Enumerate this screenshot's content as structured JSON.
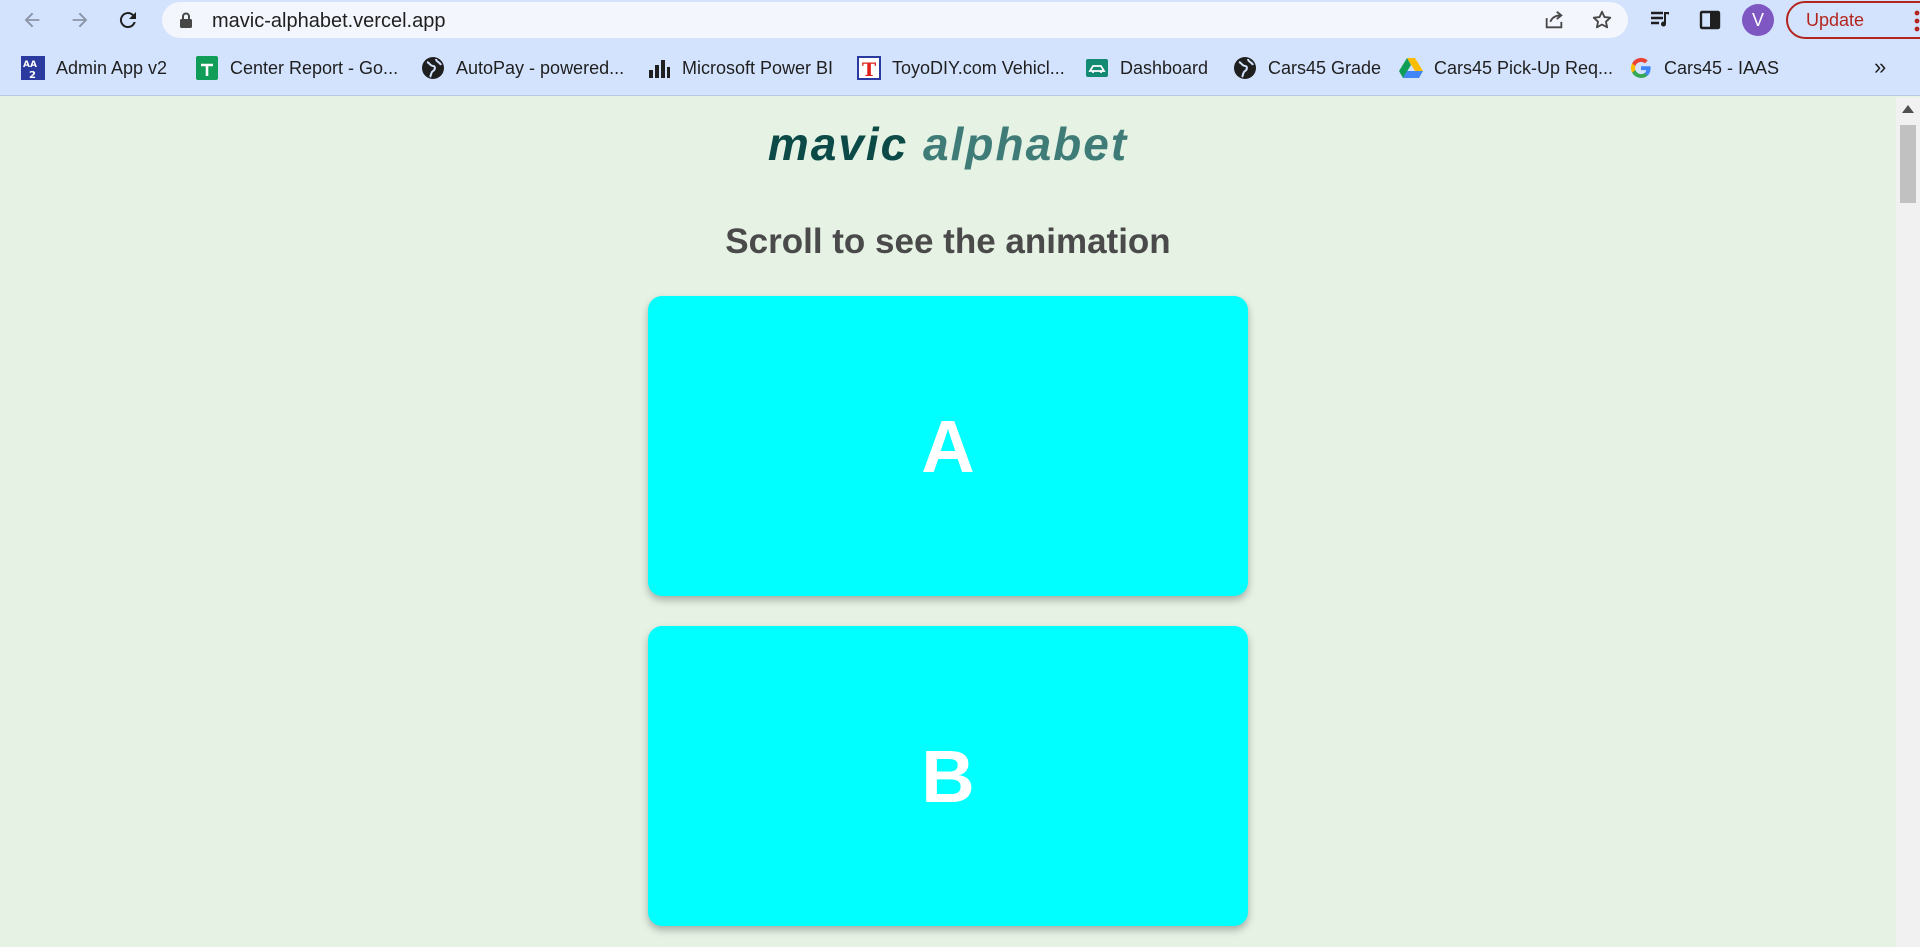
{
  "browser": {
    "url": "mavic-alphabet.vercel.app",
    "profile_initial": "V",
    "update_label": "Update"
  },
  "bookmarks": [
    {
      "label": "Admin App v2",
      "icon": "admin-app-icon"
    },
    {
      "label": "Center Report - Go...",
      "icon": "sheets-icon"
    },
    {
      "label": "AutoPay - powered...",
      "icon": "globe-icon"
    },
    {
      "label": "Microsoft Power BI",
      "icon": "power-bi-icon"
    },
    {
      "label": "ToyoDIY.com Vehicl...",
      "icon": "toyodiy-icon"
    },
    {
      "label": "Dashboard",
      "icon": "dashboard-icon"
    },
    {
      "label": "Cars45 Grade",
      "icon": "globe-icon"
    },
    {
      "label": "Cars45 Pick-Up Req...",
      "icon": "google-drive-icon"
    },
    {
      "label": "Cars45 - IAAS",
      "icon": "google-icon"
    }
  ],
  "bookmarks_overflow": "»",
  "page": {
    "title_word1": "mavic",
    "title_word2": "alphabet",
    "subtitle": "Scroll to see the animation",
    "cards": [
      {
        "letter": "A"
      },
      {
        "letter": "B"
      }
    ]
  },
  "colors": {
    "page_background": "#e5f2e4",
    "card_background": "#00ffff",
    "title_dark": "#0b4a47",
    "title_light": "#3f7c78"
  }
}
